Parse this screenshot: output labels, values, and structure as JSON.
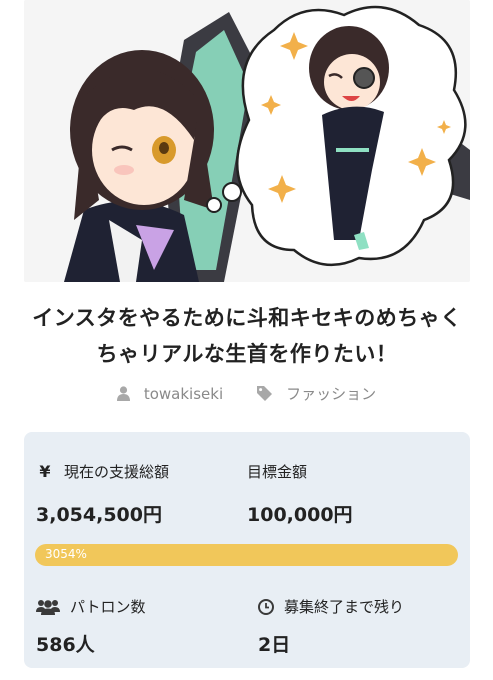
{
  "title": "インスタをやるために斗和キセキのめちゃくちゃリアルな生首を作りたい！",
  "title_line1": "インスタをやるために斗和キセキのめちゃく",
  "title_line2": "ちゃリアルな生首を作りたい！",
  "meta": {
    "author": "towakiseki",
    "category": "ファッション",
    "author_icon": "user-icon",
    "category_icon": "tag-icon"
  },
  "stats": {
    "total": {
      "icon": "yen-icon",
      "icon_glyph": "¥",
      "label": "現在の支援総額",
      "value": "3,054,500円"
    },
    "goal": {
      "label": "目標金額",
      "value": "100,000円"
    },
    "progress": {
      "text": "3054%",
      "percent": 3054
    },
    "patrons": {
      "icon": "users-icon",
      "label": "パトロン数",
      "value": "586人"
    },
    "remaining": {
      "icon": "clock-icon",
      "label": "募集終了まで残り",
      "value": "2日"
    }
  },
  "colors": {
    "progress": "#f1c75a",
    "panel": "#e8eef4",
    "accent_green": "#6fd8b4"
  }
}
